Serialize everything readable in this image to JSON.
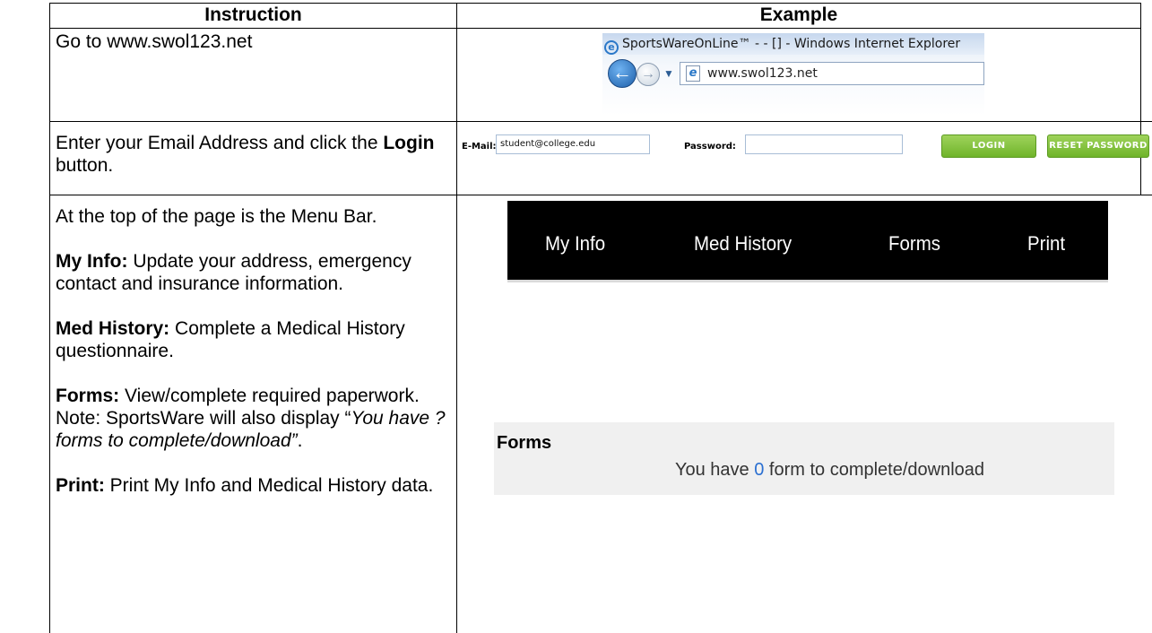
{
  "table": {
    "header_instruction": "Instruction",
    "header_example": "Example"
  },
  "row1": {
    "instruction": "Go to www.swol123.net",
    "browser": {
      "title": "SportsWareOnLine™ - - [] - Windows Internet Explorer",
      "address": "www.swol123.net",
      "icons": [
        "ie-logo-icon",
        "back-arrow-icon",
        "forward-arrow-icon",
        "dropdown-icon",
        "page-icon"
      ]
    }
  },
  "row2": {
    "instruction_pre": "Enter your Email Address and click the ",
    "instruction_bold": "Login",
    "instruction_post": " button.",
    "login_bar": {
      "email_label": "E-Mail:",
      "email_value": "student@college.edu",
      "password_label": "Password:",
      "password_value": "",
      "login_button": "Login",
      "reset_button": "Reset Password",
      "button_color": "#7fc03a"
    }
  },
  "row3": {
    "intro": "At the top of the page is the Menu Bar.",
    "myinfo_bold": "My Info:",
    "myinfo_text": " Update your address, emergency contact and insurance information.",
    "medhistory_bold": "Med History:",
    "medhistory_text": " Complete a Medical History questionnaire.",
    "forms_bold": "Forms:",
    "forms_text": " View/complete required paperwork. Note: SportsWare will also display “",
    "forms_italic": "You have ? forms to complete/download”",
    "forms_end": ".",
    "print_bold": "Print:",
    "print_text": " Print My Info and Medical History data.",
    "menu": {
      "items": [
        "My Info",
        "Med History",
        "Forms",
        "Print"
      ],
      "background": "#000000"
    },
    "forms_panel": {
      "title": "Forms",
      "msg_pre": "You have ",
      "count": "0",
      "msg_post": " form to complete/download",
      "count_color": "#2a6fd1"
    }
  }
}
